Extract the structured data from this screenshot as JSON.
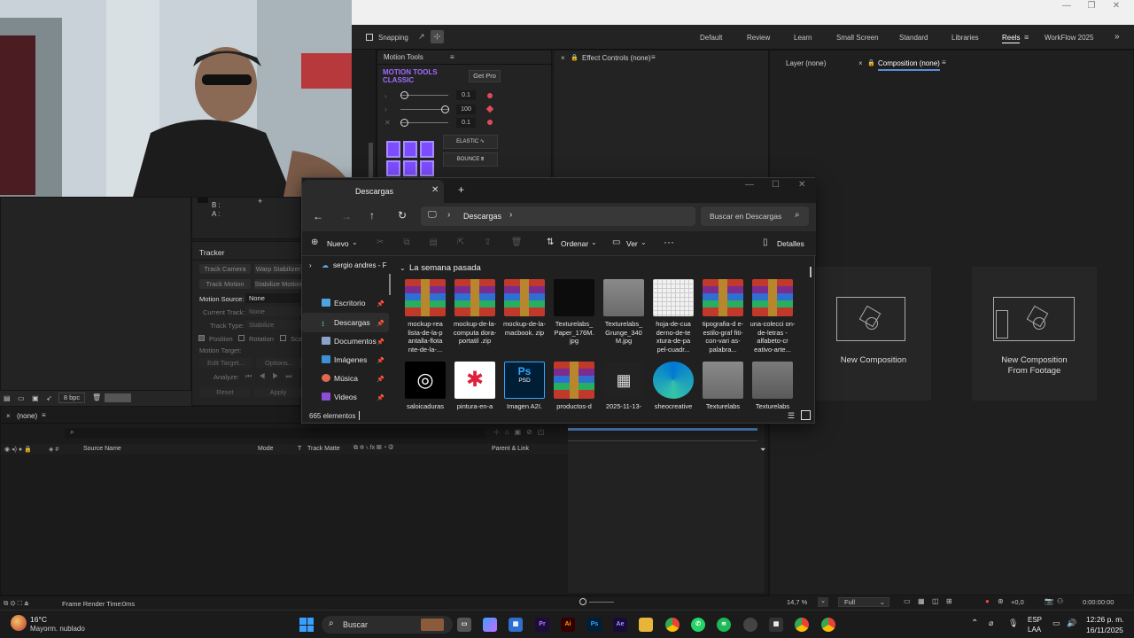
{
  "toolbar": {
    "snapping_label": "Snapping",
    "workspaces": [
      "Default",
      "Review",
      "Learn",
      "Small Screen",
      "Standard",
      "Libraries",
      "Reels",
      "WorkFlow 2025"
    ],
    "active_workspace": "Reels"
  },
  "motion_tools": {
    "tab": "Motion Tools",
    "brand_line1": "MOTION TOOLS",
    "brand_line2": "CLASSIC",
    "get_pro": "Get Pro",
    "v1": "0.1",
    "v2": "100",
    "v3": "0.1",
    "elastic": "ELASTIC",
    "bounce": "BOUNCE"
  },
  "effect_controls": {
    "tab": "Effect Controls (none)"
  },
  "viewer": {
    "layer_tab": "Layer (none)",
    "composition_tab": "Composition (none)",
    "new_composition": "New Composition",
    "new_from_footage_1": "New Composition",
    "new_from_footage_2": "From Footage",
    "zoom": "14,7 %",
    "resolution": "Full",
    "exposure": "+0,0",
    "timecode": "0:00:00:00"
  },
  "info": {
    "b": "B :",
    "a": "A :"
  },
  "tracker": {
    "title": "Tracker",
    "track_camera": "Track Camera",
    "warp_stabilizer": "Warp Stabilizer",
    "track_motion": "Track Motion",
    "stabilize_motion": "Stabilize Motion",
    "motion_source_label": "Motion Source:",
    "motion_source_value": "None",
    "current_track_label": "Current Track:",
    "current_track_value": "None",
    "track_type_label": "Track Type:",
    "track_type_value": "Stabilize",
    "position": "Position",
    "rotation": "Rotation",
    "scale": "Sca",
    "motion_target": "Motion Target:",
    "edit_target": "Edit Target...",
    "options": "Options...",
    "analyze": "Analyze:",
    "reset": "Reset",
    "apply": "Apply"
  },
  "project": {
    "bpc": "8 bpc"
  },
  "timeline": {
    "tab": "(none)",
    "columns": [
      "Source Name",
      "Mode",
      "T",
      "Track Matte",
      "Parent & Link"
    ],
    "frame_render": "Frame Render Time:",
    "frame_render_value": "0ms"
  },
  "explorer": {
    "tab_title": "Descargas",
    "breadcrumb": "Descargas",
    "search_placeholder": "Buscar en Descargas",
    "cmd_new": "Nuevo",
    "cmd_sort": "Ordenar",
    "cmd_view": "Ver",
    "cmd_details": "Detalles",
    "tree_root": "sergio andres - F",
    "nav": [
      "Escritorio",
      "Descargas",
      "Documentos",
      "Imágenes",
      "Música",
      "Videos"
    ],
    "group": "La semana pasada",
    "status": "665 elementos",
    "files_row1": [
      {
        "name": "mockup-rea lista-de-la-p antalla-flota nte-de-la-...",
        "kind": "rar"
      },
      {
        "name": "mockup-de-la-computa dora-portatil .zip",
        "kind": "rar"
      },
      {
        "name": "mockup-de-la-macbook. zip",
        "kind": "rar"
      },
      {
        "name": "Texturelabs_ Paper_176M. jpg",
        "kind": "dark"
      },
      {
        "name": "Texturelabs_ Grunge_340 M.jpg",
        "kind": "grey"
      },
      {
        "name": "hoja-de-cua derno-de-te xtura-de-pa pel-cuadr...",
        "kind": "paper"
      },
      {
        "name": "tipografia-d e-estilo-graf fiti-con-vari as-palabra...",
        "kind": "rar"
      },
      {
        "name": "una-colecci on-de-letras -alfabeto-cr eativo-arte...",
        "kind": "rar"
      }
    ],
    "files_row2": [
      {
        "name": "saloicaduras",
        "kind": "logo-white"
      },
      {
        "name": "pintura-en-a",
        "kind": "logo-red"
      },
      {
        "name": "Imagen A2I.",
        "kind": "psd"
      },
      {
        "name": "productos-d",
        "kind": "rar"
      },
      {
        "name": "2025-11-13-",
        "kind": "video"
      },
      {
        "name": "sheocreative",
        "kind": "edge"
      },
      {
        "name": "Texturelabs",
        "kind": "grey"
      },
      {
        "name": "Texturelabs",
        "kind": "grey2"
      }
    ],
    "psd_label": "PSD"
  },
  "taskbar": {
    "weather_temp": "16°C",
    "weather_desc": "Mayorm. nublado",
    "search": "Buscar",
    "lang1": "ESP",
    "lang2": "LAA",
    "time": "12:26 p. m.",
    "date": "16/11/2025"
  },
  "colors": {
    "accent_purple": "#8b5cf6",
    "ae_bg": "#232323",
    "explorer_bg": "#202020",
    "taskbar_bg": "#1b1b1b"
  }
}
